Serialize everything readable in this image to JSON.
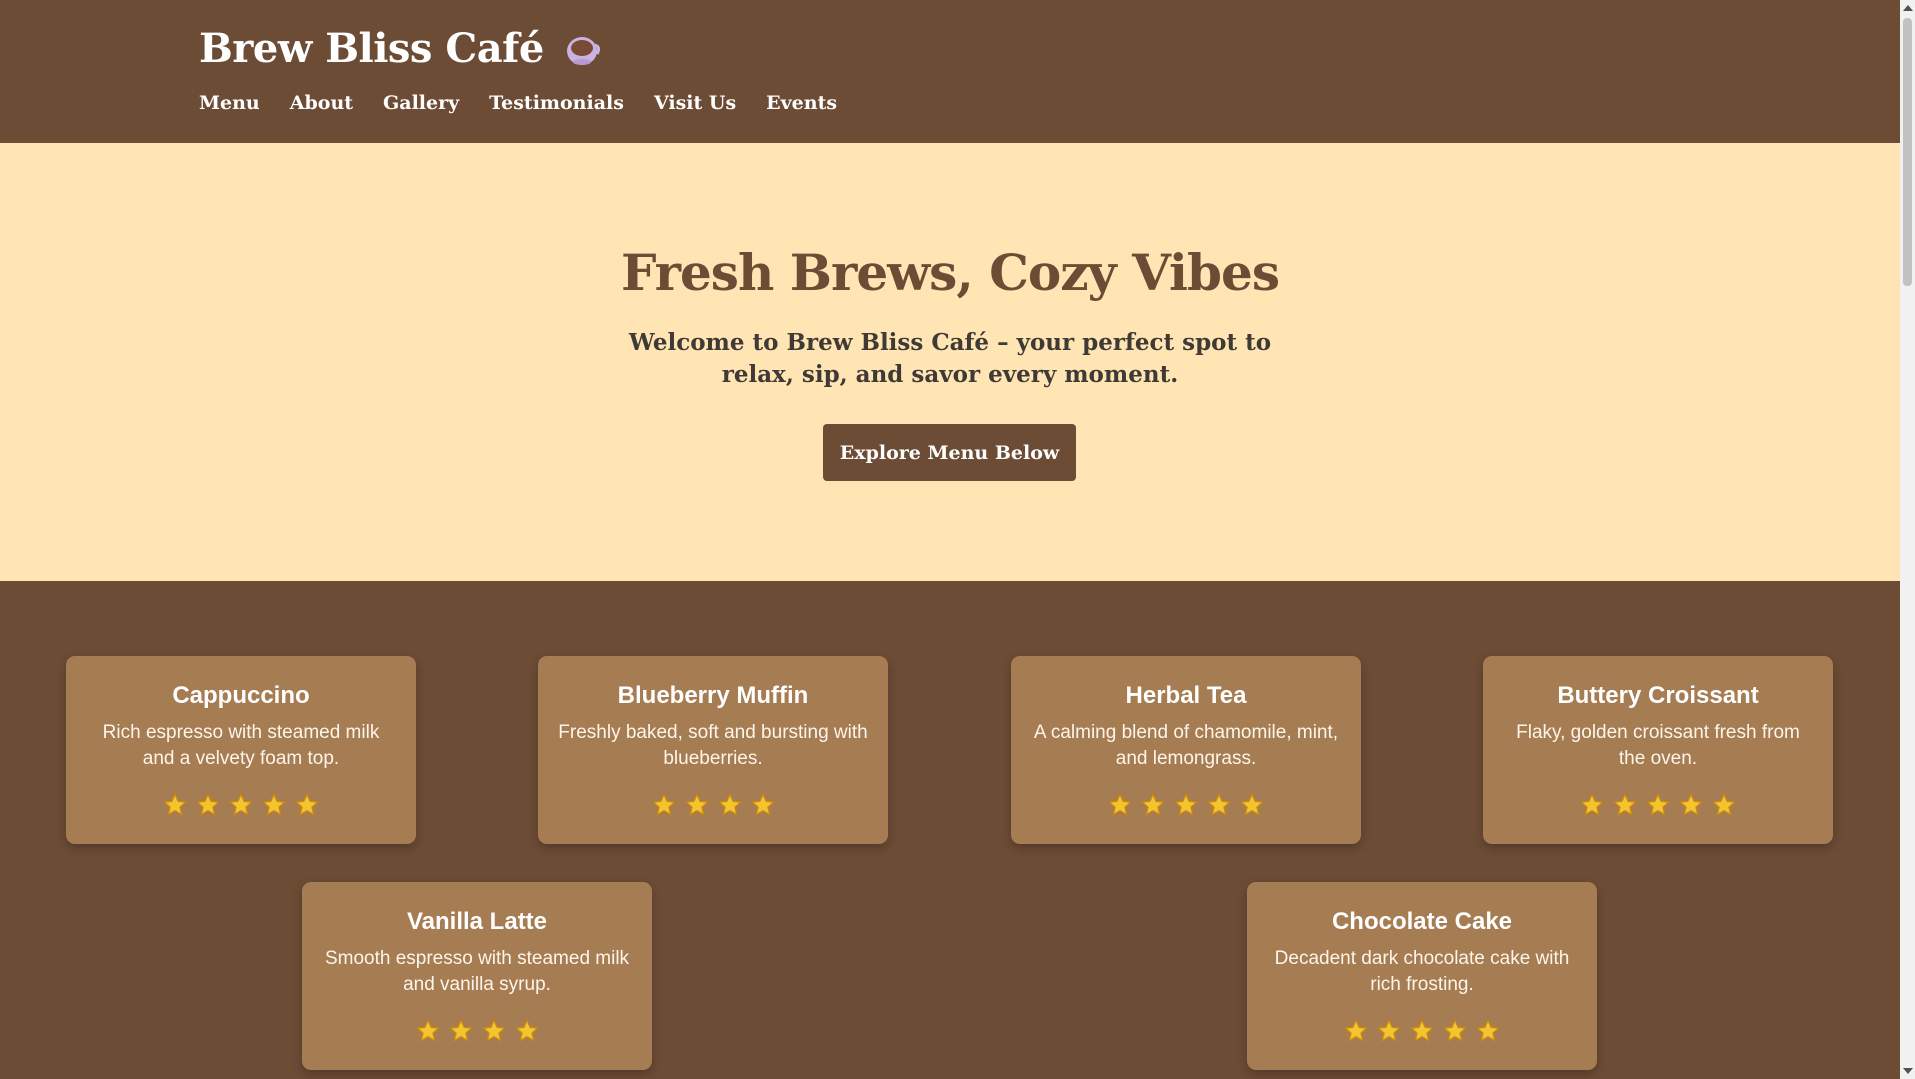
{
  "header": {
    "brand": "Brew Bliss Café",
    "brand_icon": "coffee-cup-icon",
    "nav": [
      "Menu",
      "About",
      "Gallery",
      "Testimonials",
      "Visit Us",
      "Events"
    ]
  },
  "hero": {
    "title": "Fresh Brews, Cozy Vibes",
    "subtitle": "Welcome to Brew Bliss Café – your perfect spot to relax, sip, and savor every moment.",
    "button": "Explore Menu Below"
  },
  "menu_items": [
    {
      "name": "Cappuccino",
      "description": "Rich espresso with steamed milk and a velvety foam top.",
      "rating": 5
    },
    {
      "name": "Blueberry Muffin",
      "description": "Freshly baked, soft and bursting with blueberries.",
      "rating": 4
    },
    {
      "name": "Herbal Tea",
      "description": "A calming blend of chamomile, mint, and lemongrass.",
      "rating": 5
    },
    {
      "name": "Buttery Croissant",
      "description": "Flaky, golden croissant fresh from the oven.",
      "rating": 5
    },
    {
      "name": "Vanilla Latte",
      "description": "Smooth espresso with steamed milk and vanilla syrup.",
      "rating": 4
    },
    {
      "name": "Chocolate Cake",
      "description": "Decadent dark chocolate cake with rich frosting.",
      "rating": 5
    }
  ],
  "colors": {
    "brown": "#6d4c36",
    "cream": "#ffe5b4",
    "card": "#a67c52",
    "star": "#f4c430"
  }
}
